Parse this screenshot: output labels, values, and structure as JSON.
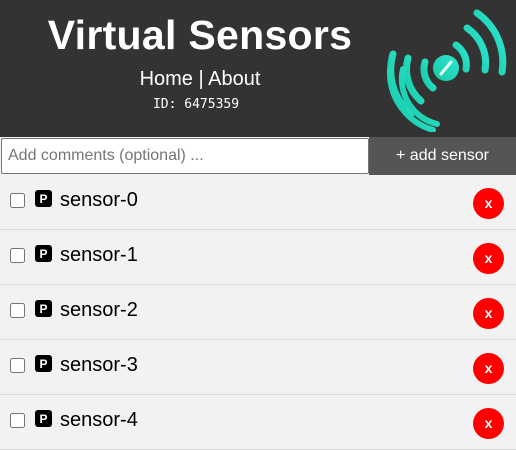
{
  "header": {
    "title": "Virtual Sensors",
    "nav": {
      "home": "Home",
      "separator": "|",
      "about": "About"
    },
    "device_id": "ID: 6475359",
    "logo_icon": "broadcast-sensor-icon",
    "colors": {
      "background": "#333333",
      "logo_gradient_start": "#19d3b4",
      "logo_gradient_end": "#18e0c8"
    }
  },
  "toolbar": {
    "comment_placeholder": "Add comments (optional) ...",
    "comment_value": "",
    "add_label": "+ add sensor"
  },
  "sensors": [
    {
      "name": "sensor-0",
      "checked": false,
      "badge": "P",
      "delete_label": "x"
    },
    {
      "name": "sensor-1",
      "checked": false,
      "badge": "P",
      "delete_label": "x"
    },
    {
      "name": "sensor-2",
      "checked": false,
      "badge": "P",
      "delete_label": "x"
    },
    {
      "name": "sensor-3",
      "checked": false,
      "badge": "P",
      "delete_label": "x"
    },
    {
      "name": "sensor-4",
      "checked": false,
      "badge": "P",
      "delete_label": "x"
    }
  ],
  "colors": {
    "delete": "#ff0000",
    "add_button": "#555555",
    "list_bg": "#f2f2f2"
  }
}
